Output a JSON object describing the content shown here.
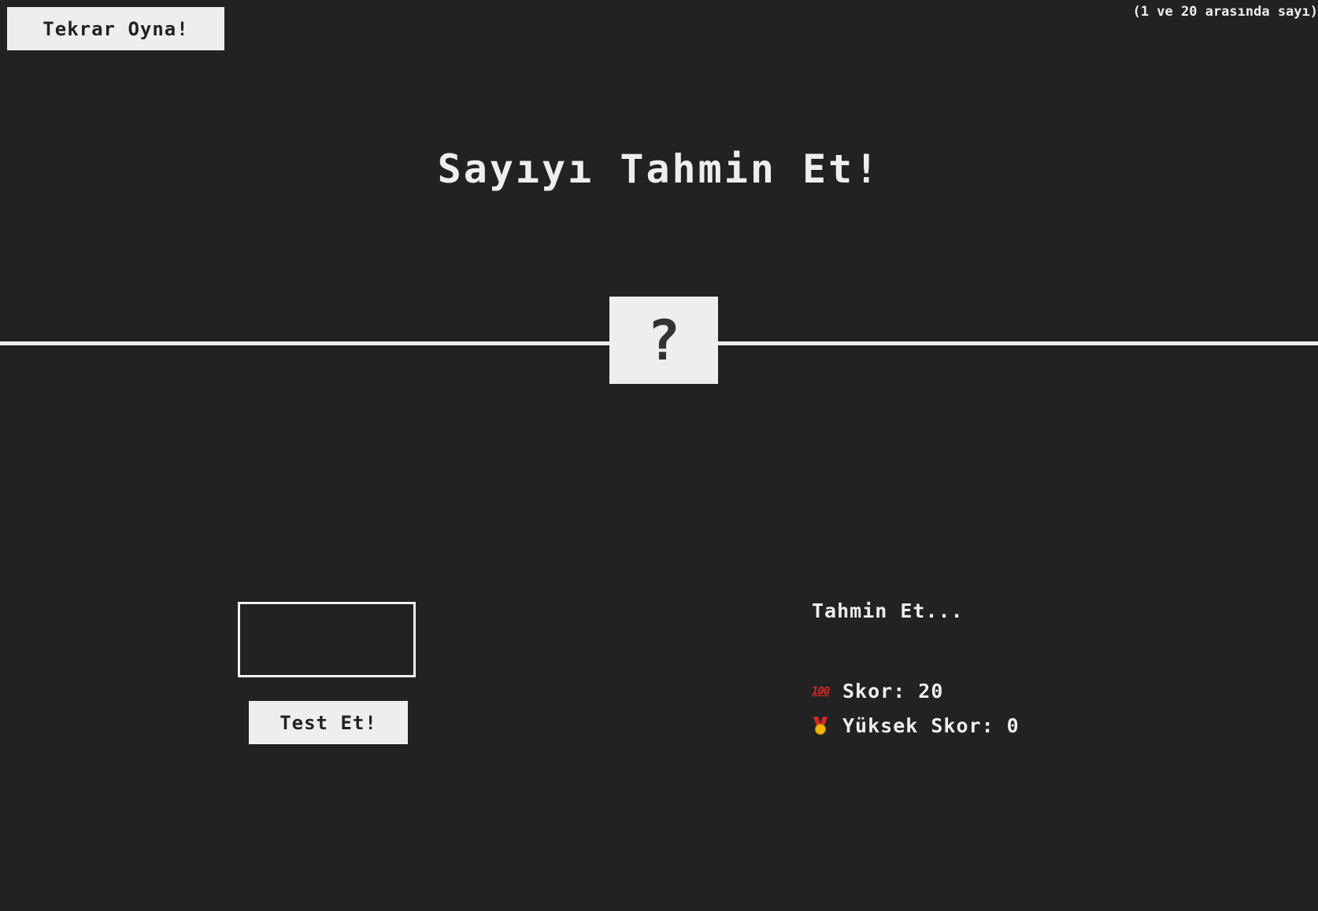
{
  "header": {
    "again_label": "Tekrar Oyna!",
    "hint": "(1 ve 20 arasında sayı)"
  },
  "title": "Sayıyı Tahmin Et!",
  "secret_number": "?",
  "guess": {
    "value": "",
    "check_label": "Test Et!"
  },
  "message": "Tahmin Et...",
  "score": {
    "icon": "hundred-points-icon",
    "label": "Skor:",
    "value": "20"
  },
  "highscore": {
    "icon": "medal-icon",
    "label": "Yüksek Skor:",
    "value": "0"
  },
  "colors": {
    "background": "#222222",
    "foreground": "#eeeeee"
  }
}
